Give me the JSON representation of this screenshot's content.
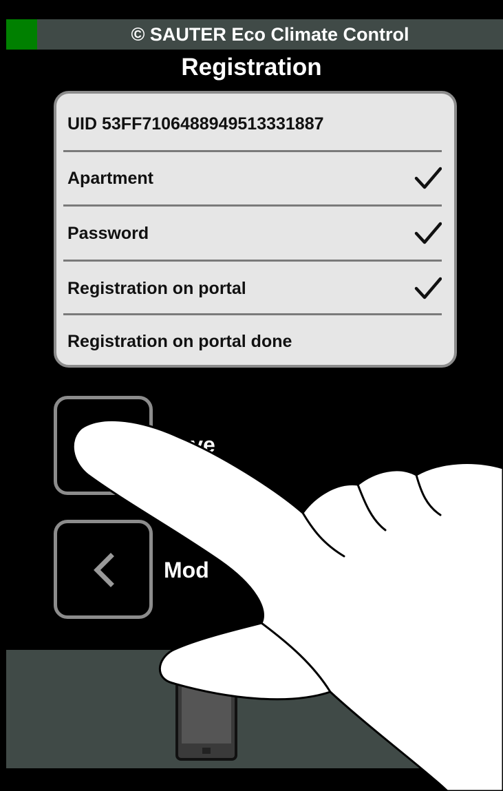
{
  "header": {
    "app_title": "© SAUTER Eco Climate Control",
    "status_color": "#008000"
  },
  "page_title": "Registration",
  "panel": {
    "uid_label": "UID  53FF7106488949513331887",
    "rows": [
      {
        "label": "Apartment",
        "checked": true
      },
      {
        "label": "Password",
        "checked": true
      },
      {
        "label": "Registration on portal",
        "checked": true
      },
      {
        "label": "Registration on portal done",
        "checked": false
      }
    ]
  },
  "actions": {
    "save_label": "Save",
    "mode_label": "Mod"
  },
  "icons": {
    "check": "check-icon",
    "back": "chevron-left-icon",
    "confirm": "confirm-check-icon",
    "device": "smartphone-icon",
    "overlay": "pointing-hand"
  },
  "colors": {
    "bar": "#404a47",
    "panel": "#e6e6e6",
    "border": "#8c8c8c"
  }
}
